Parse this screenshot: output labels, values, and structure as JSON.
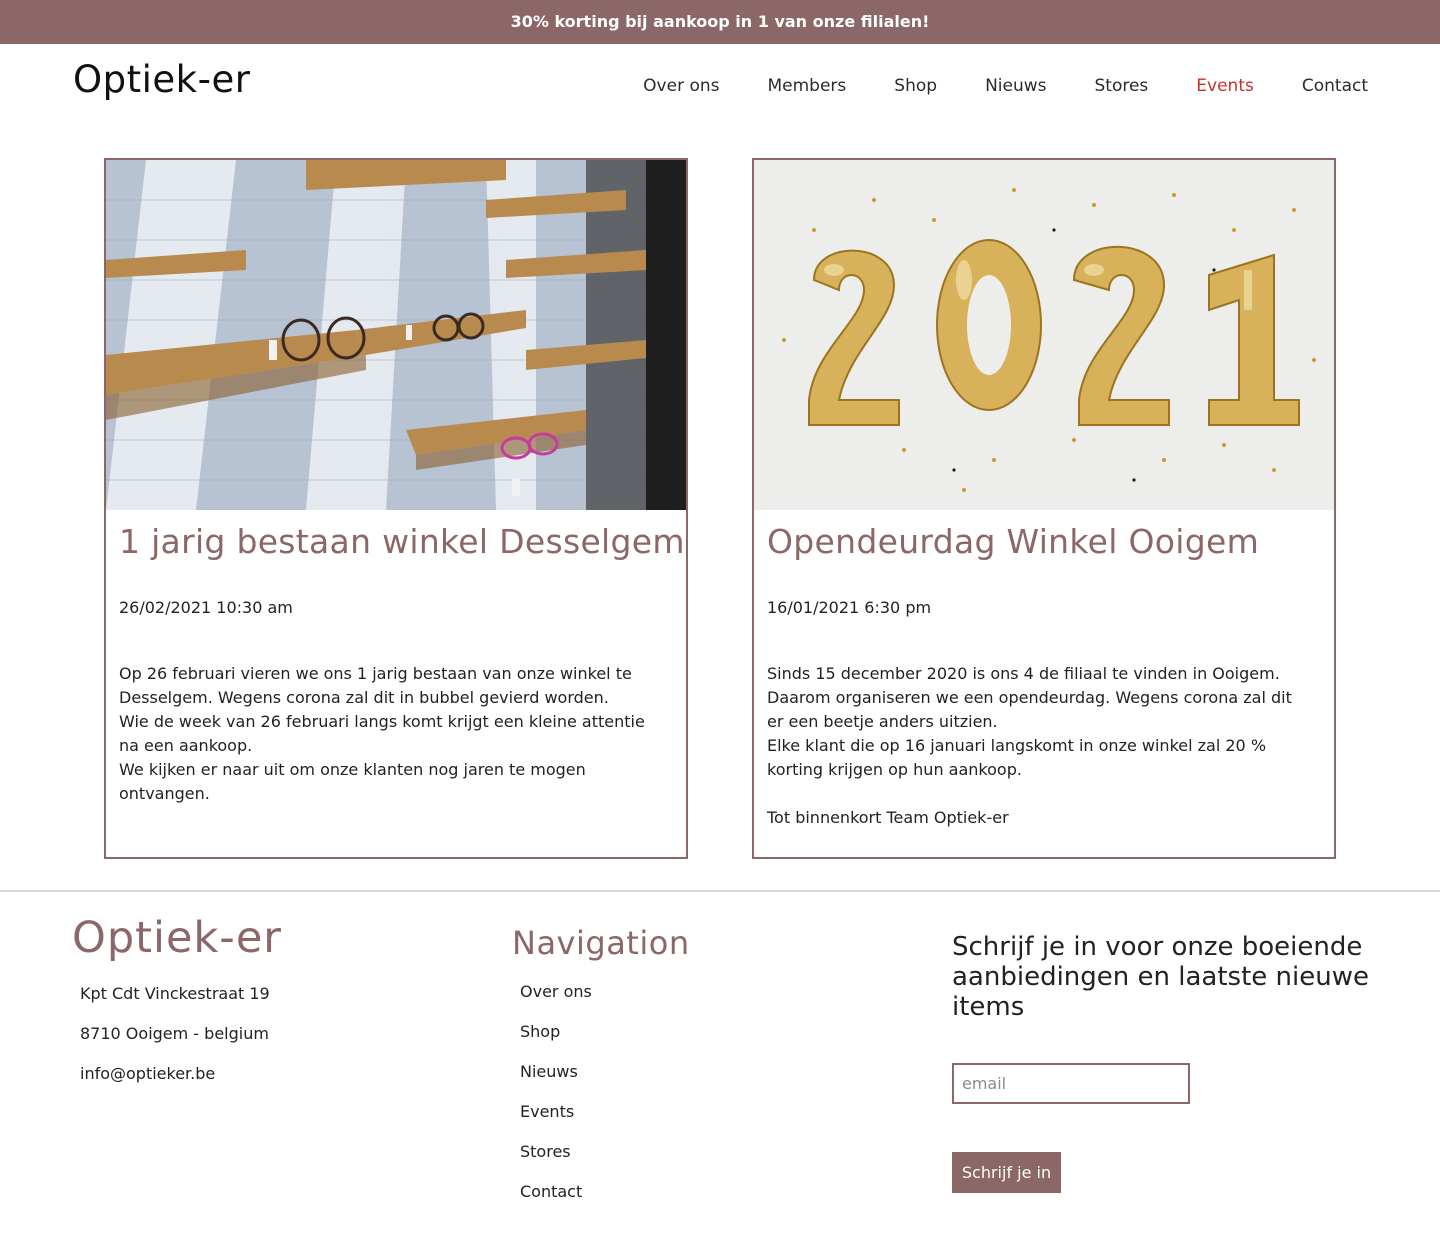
{
  "promo_bar": {
    "text": "30% korting bij aankoop in 1 van onze filialen!"
  },
  "header": {
    "logo": "Optiek-er",
    "nav": [
      "Over ons",
      "Members",
      "Shop",
      "Nieuws",
      "Stores",
      "Events",
      "Contact"
    ],
    "active_nav": "Events"
  },
  "events": [
    {
      "title": "1 jarig bestaan winkel Desselgem",
      "date": "26/02/2021 10:30 am",
      "body": [
        "Op 26 februari vieren we ons 1 jarig bestaan van onze winkel te",
        "Desselgem. Wegens corona zal dit in bubbel gevierd worden.",
        "Wie de week van 26 februari langs komt krijgt een kleine attentie",
        "na een aankoop.",
        "We kijken er naar uit om onze klanten nog jaren te mogen",
        "ontvangen."
      ]
    },
    {
      "title": "Opendeurdag Winkel Ooigem",
      "date": "16/01/2021 6:30 pm",
      "body": [
        "Sinds 15 december 2020 is ons 4 de filiaal te vinden in Ooigem.",
        "Daarom organiseren we een opendeurdag. Wegens corona zal dit",
        "er een beetje anders uitzien.",
        "Elke klant die op 16 januari langskomt in onze winkel zal 20 %",
        "korting krijgen op hun aankoop.",
        "",
        "Tot binnenkort Team Optiek-er"
      ]
    }
  ],
  "footer": {
    "logo": "Optiek-er",
    "address": [
      "Kpt Cdt Vinckestraat 19",
      "8710 Ooigem - belgium",
      "info@optieker.be"
    ],
    "nav_title": "Navigation",
    "nav": [
      "Over ons",
      "Shop",
      "Nieuws",
      "Events",
      "Stores",
      "Contact"
    ],
    "subscribe_title": "Schrijf je in voor onze boeiende aanbiedingen en laatste nieuwe items",
    "email_placeholder": "email",
    "subscribe_button": "Schrijf je in"
  },
  "colors": {
    "brand": "#8c6767",
    "active_nav": "#c9302c"
  }
}
